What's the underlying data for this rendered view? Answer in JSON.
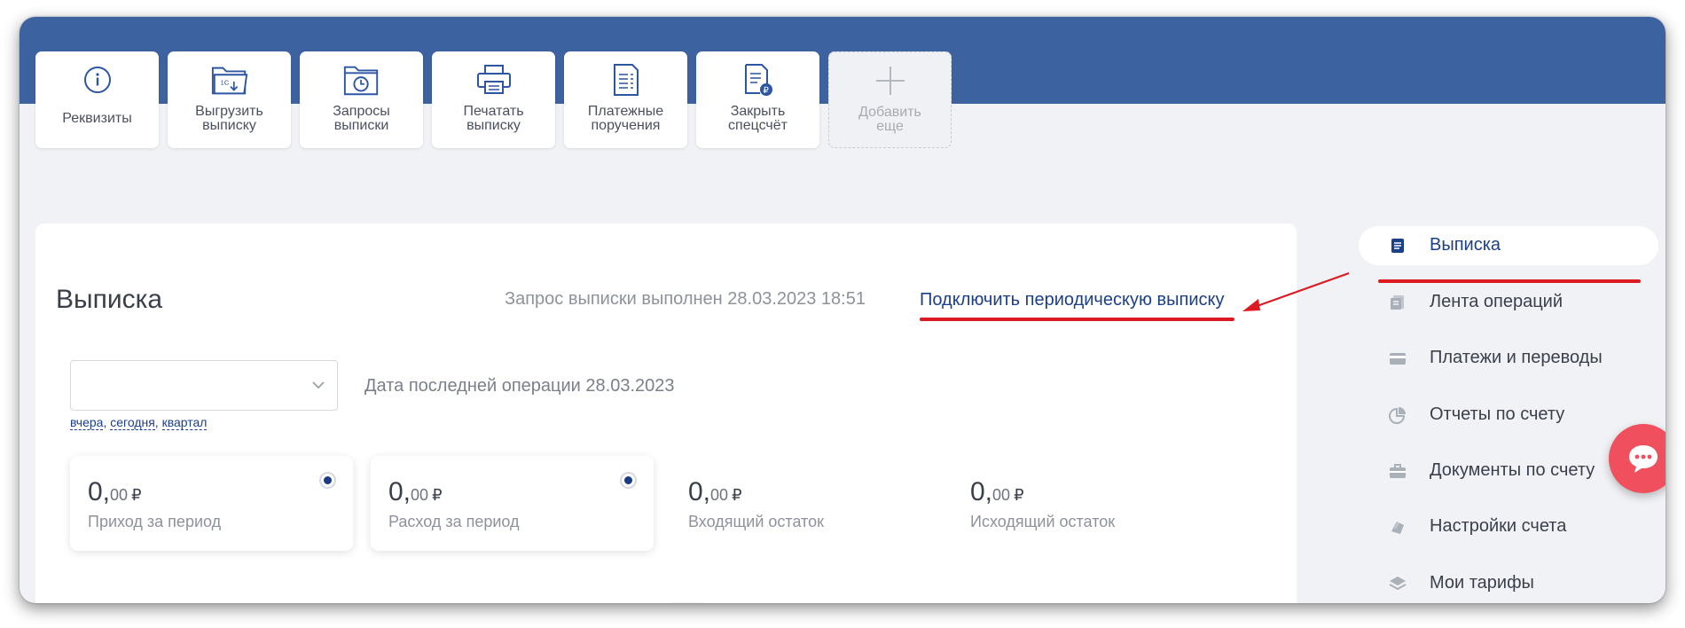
{
  "actions": [
    {
      "label": "Реквизиты",
      "icon": "info-icon"
    },
    {
      "label": "Выгрузить\nвыписку",
      "icon": "folder-1c-download-icon"
    },
    {
      "label": "Запросы\nвыписки",
      "icon": "folder-clock-icon"
    },
    {
      "label": "Печатать\nвыписку",
      "icon": "printer-icon"
    },
    {
      "label": "Платежные\nпоручения",
      "icon": "document-list-icon"
    },
    {
      "label": "Закрыть\nспецсчёт",
      "icon": "document-ruble-icon"
    },
    {
      "label": "Добавить\nеще",
      "icon": "plus-icon"
    }
  ],
  "main": {
    "title": "Выписка",
    "status": "Запрос выписки выполнен 28.03.2023 18:51",
    "periodic_link": "Подключить периодическую выписку",
    "period_select": {
      "value": ""
    },
    "last_operation": "Дата последней операции 28.03.2023",
    "quick_ranges": [
      "вчера",
      "сегодня",
      "квартал"
    ],
    "summary": [
      {
        "int": "0,",
        "dec": "00",
        "currency": "₽",
        "label": "Приход за период",
        "selectable": true
      },
      {
        "int": "0,",
        "dec": "00",
        "currency": "₽",
        "label": "Расход за период",
        "selectable": true
      },
      {
        "int": "0,",
        "dec": "00",
        "currency": "₽",
        "label": "Входящий остаток",
        "selectable": false
      },
      {
        "int": "0,",
        "dec": "00",
        "currency": "₽",
        "label": "Исходящий остаток",
        "selectable": false
      }
    ]
  },
  "sidebar": {
    "items": [
      {
        "label": "Выписка",
        "icon": "statement-icon",
        "active": true
      },
      {
        "label": "Лента операций",
        "icon": "feed-icon",
        "active": false
      },
      {
        "label": "Платежи и переводы",
        "icon": "card-icon",
        "active": false
      },
      {
        "label": "Отчеты по счету",
        "icon": "pie-chart-icon",
        "active": false
      },
      {
        "label": "Документы по счету",
        "icon": "briefcase-icon",
        "active": false
      },
      {
        "label": "Настройки счета",
        "icon": "settings-cards-icon",
        "active": false
      },
      {
        "label": "Мои тарифы",
        "icon": "layers-icon",
        "active": false
      }
    ]
  },
  "colors": {
    "header": "#3d62a0",
    "accent": "#1c3f8a",
    "annotation_red": "#dc1a22",
    "chat": "#f0505d"
  }
}
